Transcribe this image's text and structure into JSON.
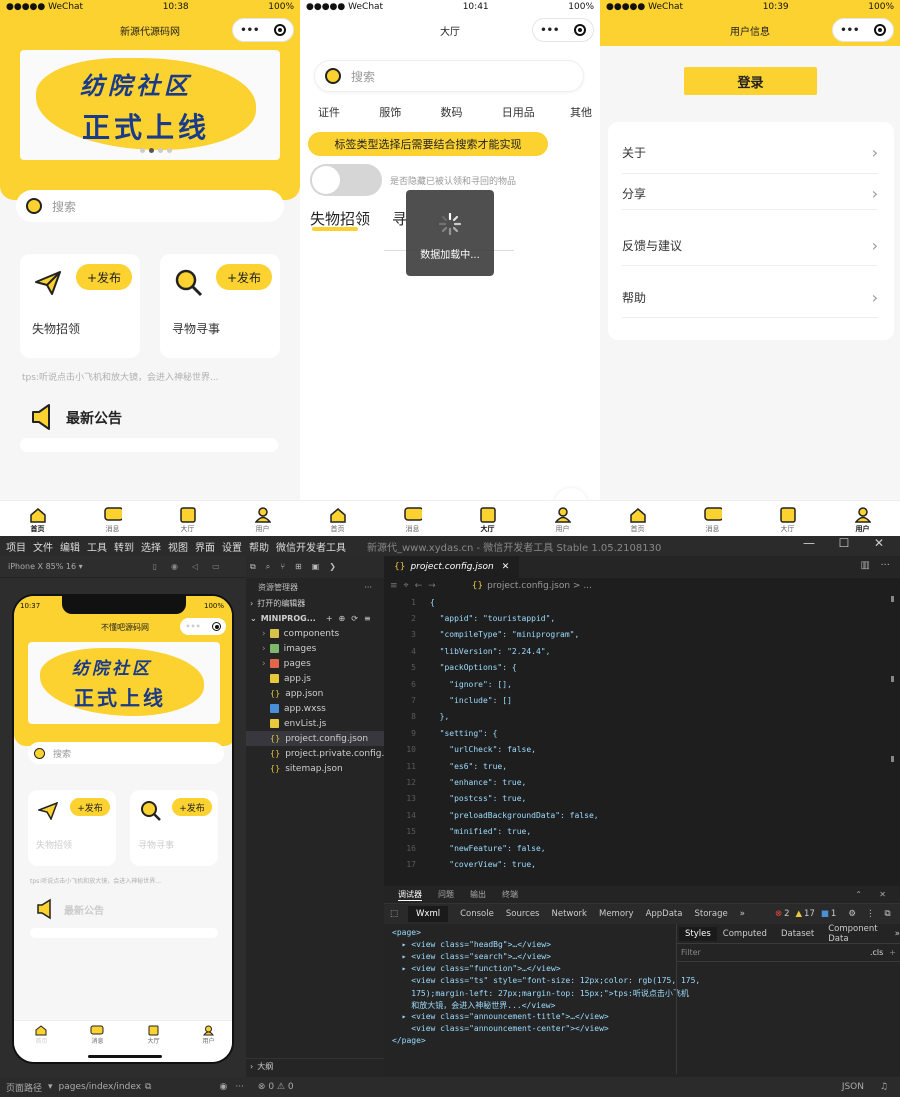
{
  "phones": {
    "home": {
      "time": "10:38",
      "carrier": "●●●●● WeChat",
      "battery": "100%",
      "title": "新源代源码网",
      "banner_line1": "纺院社区",
      "banner_line2": "正式上线",
      "search_placeholder": "搜索",
      "func": [
        {
          "label": "失物招领",
          "publish": "+发布",
          "icon": "paper-plane-icon"
        },
        {
          "label": "寻物寻事",
          "publish": "+发布",
          "icon": "magnifier-icon"
        }
      ],
      "tip": "tps:听说点击小飞机和放大镜，会进入神秘世界...",
      "announcement": "最新公告"
    },
    "hall": {
      "time": "10:41",
      "carrier": "●●●●● WeChat",
      "battery": "100%",
      "title": "大厅",
      "search_placeholder": "搜索",
      "tags": [
        "证件",
        "服饰",
        "数码",
        "日用品",
        "其他"
      ],
      "notice": "标签类型选择后需要结合搜索才能实现",
      "toggle_label": "是否隐藏已被认领和寻回的物品",
      "tab_lost": "失物招领",
      "tab_find": "寻",
      "loading": "数据加载中..."
    },
    "user": {
      "time": "10:39",
      "carrier": "●●●●● WeChat",
      "battery": "100%",
      "title": "用户信息",
      "login": "登录",
      "menu": [
        "关于",
        "分享",
        "反馈与建议",
        "帮助"
      ]
    },
    "tabbar": [
      "首页",
      "消息",
      "大厅",
      "用户"
    ],
    "capsule_dots": "•••"
  },
  "ide": {
    "menu": [
      "项目",
      "文件",
      "编辑",
      "工具",
      "转到",
      "选择",
      "视图",
      "界面",
      "设置",
      "帮助",
      "微信开发者工具"
    ],
    "window_title": "新源代_www.xydas.cn - 微信开发者工具 Stable 1.05.2108130",
    "device": "iPhone X 85% 16 ▾",
    "sim": {
      "time": "10:37",
      "battery": "100%",
      "title": "不懂吧源码网",
      "banner_line1": "纺院社区",
      "banner_line2": "正式上线",
      "search": "搜索",
      "func": [
        "失物招领",
        "寻物寻事"
      ],
      "publish": "+发布",
      "tip": "tps:听说点击小飞机和放大镜，会进入神秘世界...",
      "announcement": "最新公告",
      "tabs": [
        "首页",
        "消息",
        "大厅",
        "用户"
      ]
    },
    "explorer": {
      "title": "资源管理器",
      "more": "···",
      "open_editors": "打开的编辑器",
      "project": "MINIPROG...",
      "files": [
        {
          "name": "components",
          "type": "folder"
        },
        {
          "name": "images",
          "type": "folder"
        },
        {
          "name": "pages",
          "type": "folder-red"
        },
        {
          "name": "app.js",
          "type": "js"
        },
        {
          "name": "app.json",
          "type": "json"
        },
        {
          "name": "app.wxss",
          "type": "wxss"
        },
        {
          "name": "envList.js",
          "type": "js"
        },
        {
          "name": "project.config.json",
          "type": "json"
        },
        {
          "name": "project.private.config.js...",
          "type": "json"
        },
        {
          "name": "sitemap.json",
          "type": "json"
        }
      ],
      "outline": "大纲"
    },
    "editor": {
      "tab": "project.config.json",
      "breadcrumb": "project.config.json > ...",
      "lines": [
        {
          "n": "1",
          "t": "{"
        },
        {
          "n": "2",
          "t": "  \"appid\": \"touristappid\","
        },
        {
          "n": "3",
          "t": "  \"compileType\": \"miniprogram\","
        },
        {
          "n": "4",
          "t": "  \"libVersion\": \"2.24.4\","
        },
        {
          "n": "5",
          "t": "  \"packOptions\": {"
        },
        {
          "n": "6",
          "t": "    \"ignore\": [],"
        },
        {
          "n": "7",
          "t": "    \"include\": []"
        },
        {
          "n": "8",
          "t": "  },"
        },
        {
          "n": "9",
          "t": "  \"setting\": {"
        },
        {
          "n": "10",
          "t": "    \"urlCheck\": false,"
        },
        {
          "n": "11",
          "t": "    \"es6\": true,"
        },
        {
          "n": "12",
          "t": "    \"enhance\": true,"
        },
        {
          "n": "13",
          "t": "    \"postcss\": true,"
        },
        {
          "n": "14",
          "t": "    \"preloadBackgroundData\": false,"
        },
        {
          "n": "15",
          "t": "    \"minified\": true,"
        },
        {
          "n": "16",
          "t": "    \"newFeature\": false,"
        },
        {
          "n": "17",
          "t": "    \"coverView\": true,"
        }
      ]
    },
    "panel_tabs": [
      "调试器",
      "问题",
      "输出",
      "终端"
    ],
    "devtools_tabs": [
      "Wxml",
      "Console",
      "Sources",
      "Network",
      "Memory",
      "AppData",
      "Storage",
      "»"
    ],
    "badges": {
      "errors": "2",
      "warnings": "17",
      "info": "1"
    },
    "styles_tabs": [
      "Styles",
      "Computed",
      "Dataset",
      "Component Data",
      "»"
    ],
    "filter": "Filter",
    "cls": ".cls",
    "wxml": [
      "<page>",
      "  ▸ <view class=\"headBg\">…</view>",
      "  ▸ <view class=\"search\">…</view>",
      "  ▸ <view class=\"function\">…</view>",
      "    <view class=\"ts\" style=\"font-size: 12px;color: rgb(175, 175,",
      "    175);margin-left: 27px;margin-top: 15px;\">tps:听说点击小飞机",
      "    和放大镜，会进入神秘世界...</view>",
      "  ▸ <view class=\"announcement-title\">…</view>",
      "    <view class=\"announcement-center\"></view>",
      "</page>"
    ],
    "status": {
      "path_label": "页面路径",
      "path": "pages/index/index",
      "errors": "⊗ 0 ⚠ 0",
      "right": "JSON"
    }
  }
}
